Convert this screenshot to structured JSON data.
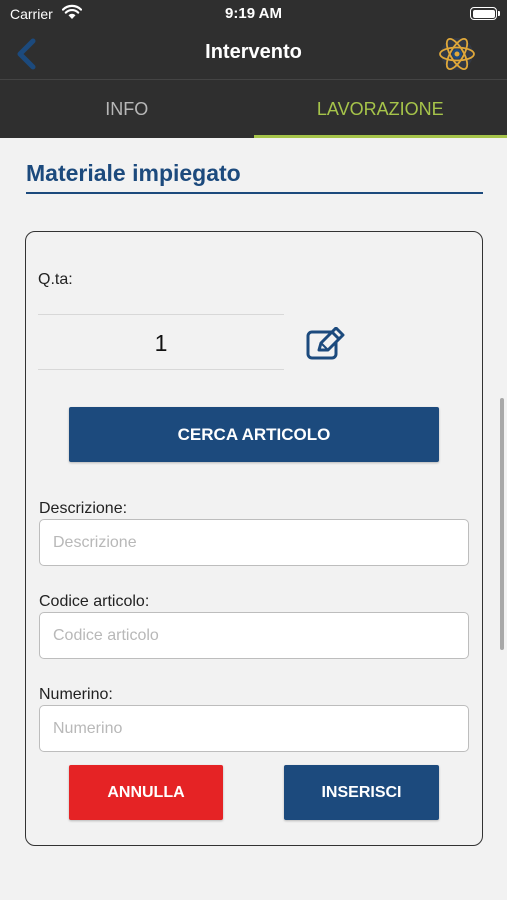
{
  "status_bar": {
    "carrier": "Carrier",
    "time": "9:19 AM"
  },
  "nav": {
    "title": "Intervento",
    "back_icon": "chevron-left-icon",
    "logo_icon": "atom-logo-icon"
  },
  "tabs": [
    {
      "label": "INFO",
      "active": false
    },
    {
      "label": "LAVORAZIONE",
      "active": true
    }
  ],
  "section": {
    "title": "Materiale impiegato"
  },
  "form": {
    "qty_label": "Q.ta:",
    "qty_value": "1",
    "search_button": "CERCA ARTICOLO",
    "description": {
      "label": "Descrizione:",
      "placeholder": "Descrizione",
      "value": ""
    },
    "article_code": {
      "label": "Codice articolo:",
      "placeholder": "Codice articolo",
      "value": ""
    },
    "number": {
      "label": "Numerino:",
      "placeholder": "Numerino",
      "value": ""
    },
    "cancel_button": "ANNULLA",
    "insert_button": "INSERISCI"
  },
  "colors": {
    "primary": "#1c4a7d",
    "accent": "#a6c44a",
    "danger": "#e52325",
    "header": "#2f2f2f"
  }
}
